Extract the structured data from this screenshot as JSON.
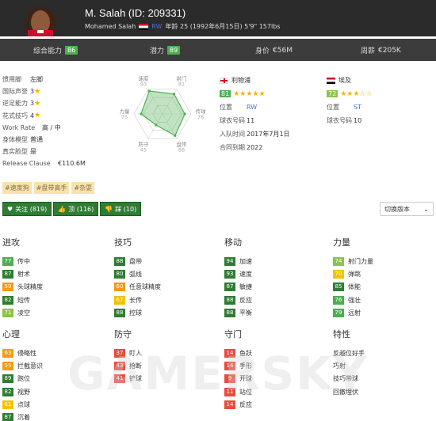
{
  "header": {
    "title": "M. Salah (ID: 209331)",
    "fullname": "Mohamed Salah",
    "position": "RW",
    "details": "年龄 25 (1992年6月15日) 5'9\" 157lbs"
  },
  "summary": [
    {
      "label": "综合能力",
      "value": "86"
    },
    {
      "label": "潜力",
      "value": "89"
    },
    {
      "label": "身价",
      "value": "€56M"
    },
    {
      "label": "周薪",
      "value": "€205K"
    }
  ],
  "info": [
    {
      "label": "惯用脚",
      "value": "左脚"
    },
    {
      "label": "国际声誉",
      "value": "3",
      "stars": 1
    },
    {
      "label": "逆足能力",
      "value": "3",
      "stars": 1
    },
    {
      "label": "花式技巧",
      "value": "4",
      "stars": 1
    },
    {
      "label": "Work Rate",
      "value": "高 / 中"
    },
    {
      "label": "身体模型",
      "value": "普通"
    },
    {
      "label": "真实脸型",
      "value": "是"
    },
    {
      "label": "Release Clause",
      "value": "€110.6M"
    }
  ],
  "radar": {
    "labels": [
      {
        "name": "速度",
        "value": "93"
      },
      {
        "name": "射门",
        "value": "81"
      },
      {
        "name": "传球",
        "value": "78"
      },
      {
        "name": "盘带",
        "value": "88"
      },
      {
        "name": "防守",
        "value": "45"
      },
      {
        "name": "力量",
        "value": "75"
      }
    ],
    "color": "#4caf50"
  },
  "club": {
    "name": "利物浦",
    "rating": "81",
    "stars": "★★★★★",
    "rows": [
      {
        "label": "位置",
        "value": "RW"
      },
      {
        "label": "球衣号码",
        "value": "11"
      },
      {
        "label": "入队时间",
        "value": "2017年7月1日"
      },
      {
        "label": "合同到期",
        "value": "2022"
      }
    ]
  },
  "nation": {
    "name": "埃及",
    "rating": "72",
    "stars": "★★★☆☆",
    "rows": [
      {
        "label": "位置",
        "value": "ST"
      },
      {
        "label": "球衣号码",
        "value": "10"
      }
    ]
  },
  "tags": [
    "#速度狗",
    "#盘带高手",
    "#杂耍"
  ],
  "buttons": [
    {
      "icon": "♥",
      "label": "关注 (819)"
    },
    {
      "icon": "👍",
      "label": "顶 (116)"
    },
    {
      "icon": "👎",
      "label": "踩 (10)"
    }
  ],
  "version_label": "切换版本",
  "sections": [
    {
      "title": "进攻",
      "attrs": [
        {
          "v": "77",
          "c": "c-g",
          "n": "传中"
        },
        {
          "v": "87",
          "c": "c-dg",
          "n": "射术"
        },
        {
          "v": "59",
          "c": "c-o",
          "n": "头球精度"
        },
        {
          "v": "82",
          "c": "c-dg",
          "n": "短传"
        },
        {
          "v": "71",
          "c": "c-lg",
          "n": "凌空"
        }
      ]
    },
    {
      "title": "技巧",
      "attrs": [
        {
          "v": "88",
          "c": "c-dg",
          "n": "盘带"
        },
        {
          "v": "80",
          "c": "c-dg",
          "n": "弧线"
        },
        {
          "v": "60",
          "c": "c-o",
          "n": "任意球精度"
        },
        {
          "v": "67",
          "c": "c-y",
          "n": "长传"
        },
        {
          "v": "88",
          "c": "c-dg",
          "n": "控球"
        }
      ]
    },
    {
      "title": "移动",
      "attrs": [
        {
          "v": "94",
          "c": "c-dg",
          "n": "加速"
        },
        {
          "v": "93",
          "c": "c-dg",
          "n": "速度"
        },
        {
          "v": "87",
          "c": "c-dg",
          "n": "敏捷"
        },
        {
          "v": "88",
          "c": "c-dg",
          "n": "反应"
        },
        {
          "v": "88",
          "c": "c-dg",
          "n": "平衡"
        }
      ]
    },
    {
      "title": "力量",
      "attrs": [
        {
          "v": "74",
          "c": "c-lg",
          "n": "射门力量"
        },
        {
          "v": "70",
          "c": "c-y",
          "n": "弹跳"
        },
        {
          "v": "85",
          "c": "c-dg",
          "n": "体能"
        },
        {
          "v": "76",
          "c": "c-g",
          "n": "强壮"
        },
        {
          "v": "79",
          "c": "c-g",
          "n": "远射"
        }
      ]
    },
    {
      "title": "心理",
      "attrs": [
        {
          "v": "63",
          "c": "c-o",
          "n": "侵略性"
        },
        {
          "v": "55",
          "c": "c-o",
          "n": "拦截意识"
        },
        {
          "v": "89",
          "c": "c-dg",
          "n": "跑位"
        },
        {
          "v": "82",
          "c": "c-dg",
          "n": "视野"
        },
        {
          "v": "61",
          "c": "c-y",
          "n": "点球"
        },
        {
          "v": "87",
          "c": "c-dg",
          "n": "沉着"
        }
      ]
    },
    {
      "title": "防守",
      "attrs": [
        {
          "v": "37",
          "c": "c-r",
          "n": "盯人"
        },
        {
          "v": "43",
          "c": "c-r",
          "n": "抢断"
        },
        {
          "v": "41",
          "c": "c-r",
          "n": "铲球"
        }
      ]
    },
    {
      "title": "守门",
      "attrs": [
        {
          "v": "14",
          "c": "c-r",
          "n": "鱼跃"
        },
        {
          "v": "14",
          "c": "c-r",
          "n": "手形"
        },
        {
          "v": "9",
          "c": "c-r",
          "n": "开球"
        },
        {
          "v": "11",
          "c": "c-r",
          "n": "站位"
        },
        {
          "v": "14",
          "c": "c-r",
          "n": "反应"
        }
      ]
    },
    {
      "title": "特性",
      "attrs": [
        {
          "n": "反越位好手"
        },
        {
          "n": "巧射"
        },
        {
          "n": "技巧带球"
        },
        {
          "n": "回撤埋伏"
        }
      ]
    }
  ],
  "watermark": "GAMERSKY"
}
